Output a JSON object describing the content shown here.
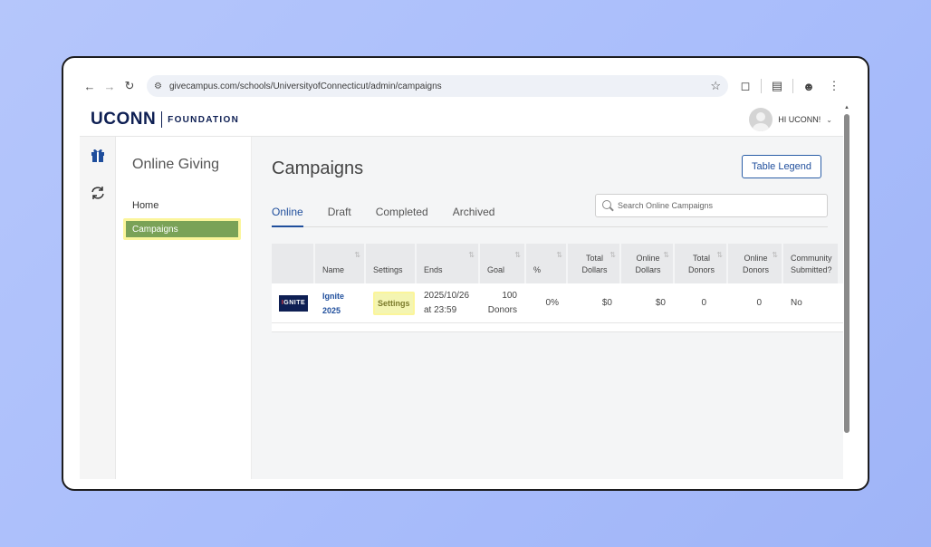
{
  "browser": {
    "url": "givecampus.com/schools/UniversityofConnecticut/admin/campaigns"
  },
  "header": {
    "logo_main": "UCONN",
    "logo_sub": "FOUNDATION",
    "user_label": "HI UCONN!"
  },
  "rail": {
    "icons": [
      "gift-icon",
      "sync-icon"
    ]
  },
  "subnav": {
    "title": "Online Giving",
    "items": [
      {
        "label": "Home"
      },
      {
        "label": "Campaigns",
        "active": true
      }
    ]
  },
  "main": {
    "title": "Campaigns",
    "legend_button": "Table Legend",
    "tabs": [
      {
        "label": "Online",
        "active": true
      },
      {
        "label": "Draft"
      },
      {
        "label": "Completed"
      },
      {
        "label": "Archived"
      }
    ],
    "search_placeholder": "Search Online Campaigns",
    "table": {
      "columns": [
        "",
        "Name",
        "Settings",
        "Ends",
        "Goal",
        "%",
        "Total Dollars",
        "Online Dollars",
        "Total Donors",
        "Online Donors",
        "Community Submitted?"
      ],
      "rows": [
        {
          "thumb_text": "IGNITE",
          "name": "Ignite 2025",
          "settings": "Settings",
          "ends": "2025/10/26 at 23:59",
          "goal": "100 Donors",
          "percent": "0%",
          "total_dollars": "$0",
          "online_dollars": "$0",
          "total_donors": "0",
          "online_donors": "0",
          "community_submitted": "No"
        }
      ]
    }
  },
  "colors": {
    "brand_navy": "#0e1f53",
    "link_blue": "#1f4e9c",
    "highlight_yellow": "#fbf59b",
    "active_green": "#7aa257"
  }
}
